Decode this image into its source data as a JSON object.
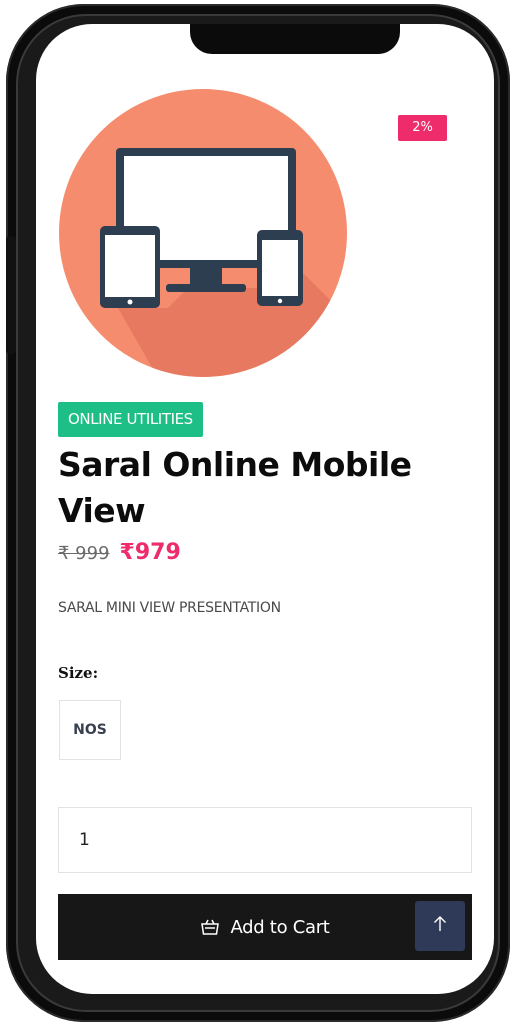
{
  "product": {
    "discount_badge": "2%",
    "category": "ONLINE UTILITIES",
    "title": "Saral Online Mobile View",
    "old_price": "₹ 999",
    "new_price": "₹979",
    "short_description": "SARAL MINI VIEW PRESENTATION",
    "image_icon": "devices-icon",
    "colors": {
      "badge": "#ee2c6c",
      "category": "#1dbf86",
      "price": "#ee2c6c",
      "image_circle": "#f58c6e",
      "device": "#2c3e50"
    }
  },
  "options": {
    "size_label": "Size:",
    "sizes": [
      "NOS"
    ],
    "selected_size": "NOS"
  },
  "cart": {
    "quantity": "1",
    "add_to_cart_label": "Add to Cart",
    "cart_icon": "basket-icon",
    "scroll_top_icon": "arrow-up-icon"
  }
}
